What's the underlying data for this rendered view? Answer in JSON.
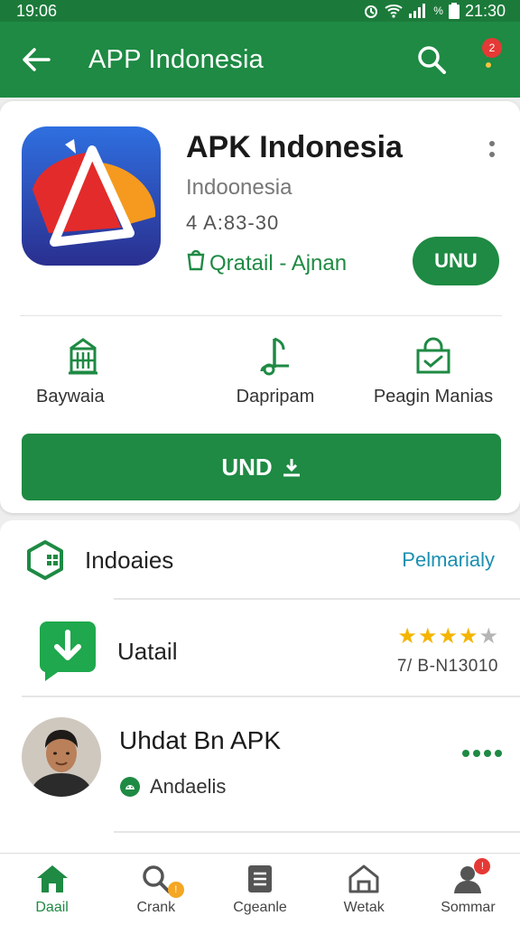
{
  "status_bar": {
    "time_left": "19:06",
    "battery_text": "%",
    "time_right": "21:30"
  },
  "app_bar": {
    "title": "APP Indonesia",
    "badge": "2"
  },
  "app": {
    "name": "APK Indonesia",
    "developer": "Indoonesia",
    "version": "4 A:83-30",
    "category": "Qratail - Ajnan",
    "small_button": "UNU",
    "features": [
      "Baywaia",
      "Dapripam",
      "Peagin Manias"
    ],
    "install_button": "UND"
  },
  "section": {
    "title": "Indoaies",
    "link": "Pelmarialy",
    "update_row": {
      "label": "Uatail",
      "rating": 4,
      "rating_text": "7/ B-N13010"
    },
    "user_row": {
      "title": "Uhdat Bn APK",
      "subtitle": "Andaelis"
    }
  },
  "bottom_nav": [
    {
      "label": "Daail",
      "icon": "home-icon"
    },
    {
      "label": "Crank",
      "icon": "search-icon",
      "badge": "!"
    },
    {
      "label": "Cgeanle",
      "icon": "document-icon"
    },
    {
      "label": "Wetak",
      "icon": "house-outline-icon"
    },
    {
      "label": "Sommar",
      "icon": "person-icon",
      "badge": "!"
    }
  ],
  "colors": {
    "primary": "#1e8a43",
    "status_bar": "#1b7a3a",
    "link": "#1b8fb0",
    "star": "#f4b400"
  }
}
